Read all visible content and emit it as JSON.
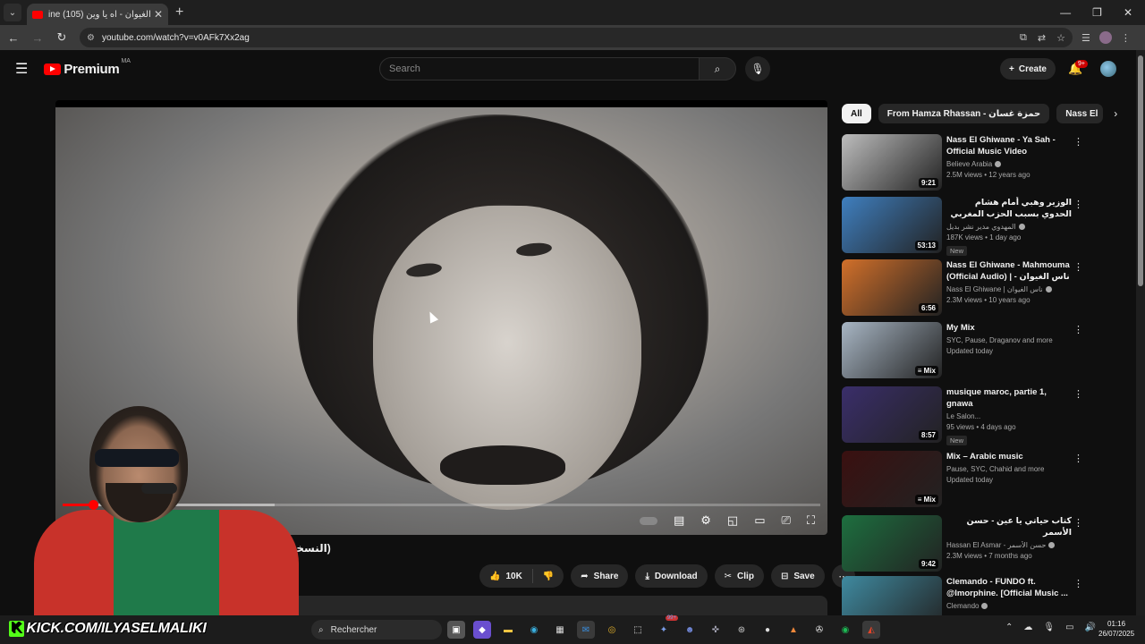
{
  "browser": {
    "tab_title": "ine ناس الغيوان - اه يا وين (105)",
    "tab_close": "✕",
    "new_tab": "+",
    "url": "youtube.com/watch?v=v0AFk7Xx2ag",
    "window": {
      "minimize": "—",
      "restore": "❐",
      "close": "✕"
    }
  },
  "youtube": {
    "logo_text": "Premium",
    "country_code": "MA",
    "search_placeholder": "Search",
    "create_label": "Create",
    "notif_count": "9+"
  },
  "video": {
    "title_visible": "(النسخة الاصـ",
    "progress_played": 0.04,
    "progress_loaded": 0.28
  },
  "actions": {
    "like_count": "10K",
    "share": "Share",
    "download": "Download",
    "clip": "Clip",
    "save": "Save"
  },
  "chips": [
    "All",
    "From Hamza Rhassan - حمزة غسان",
    "Nass El"
  ],
  "recommendations": [
    {
      "title": "Nass El Ghiwane - Ya Sah - Official Music Video",
      "channel": "Believe Arabia",
      "verified": true,
      "meta": "2.5M views • 12 years ago",
      "duration": "9:21",
      "new": false,
      "rtl": false,
      "thumb_color": "#bdbdbd"
    },
    {
      "title": "الوزير وهبي أمام هشام الحدوي بسبب الحزب المغربي الحر",
      "channel": "المهدوي مدير نشر بديل",
      "verified": true,
      "meta": "187K views • 1 day ago",
      "duration": "53:13",
      "new": true,
      "new_label": "New",
      "rtl": true,
      "thumb_color": "#3f7fbf"
    },
    {
      "title": "Nass El Ghiwane - Mahmouma (Official Audio) | ناس الغيوان - مهمومة",
      "channel": "Nass El Ghiwane | ناس الغيوان",
      "verified": true,
      "meta": "2.3M views • 10 years ago",
      "duration": "6:56",
      "new": false,
      "rtl": false,
      "thumb_color": "#d2702a"
    },
    {
      "title": "My Mix",
      "channel": "SYC, Pause, Draganov and more",
      "verified": false,
      "meta": "Updated today",
      "duration": "Mix",
      "mix": true,
      "new": false,
      "rtl": false,
      "thumb_color": "#a8b6c4"
    },
    {
      "title": "musique maroc, partie 1, gnawa",
      "channel": "Le Salon...",
      "verified": false,
      "meta": "95 views • 4 days ago",
      "duration": "8:57",
      "new": true,
      "new_label": "New",
      "rtl": false,
      "thumb_color": "#3a2e6a"
    },
    {
      "title": "Mix – Arabic music",
      "channel": "Pause, SYC, Chahid and more",
      "verified": false,
      "meta": "Updated today",
      "duration": "Mix",
      "mix": true,
      "new": false,
      "rtl": false,
      "thumb_color": "#3a1010"
    },
    {
      "title": "كتاب حياتي يا عين - حسن الأسمر",
      "channel": "Hassan El Asmar - حسن الأسمر",
      "verified": true,
      "meta": "2.3M views • 7 months ago",
      "duration": "9:42",
      "new": false,
      "rtl": true,
      "thumb_color": "#1d6f3f"
    },
    {
      "title": "Clemando - FUNDO ft. @lmorphine. [Official Music ...",
      "channel": "Clemando",
      "verified": true,
      "meta": "",
      "duration": "",
      "new": false,
      "rtl": false,
      "thumb_color": "#3f8aa0"
    }
  ],
  "taskbar": {
    "kick_text": "KICK.COM/ILYASELMALIKI",
    "kick_k": "K",
    "search_placeholder": "Rechercher",
    "notif_badge": "99+",
    "time": "01:16",
    "date": "26/07/2025"
  },
  "icons": {
    "tab_menu": "chevron-down-icon",
    "back": "arrow-left-icon",
    "forward": "arrow-right-icon",
    "reload": "reload-icon",
    "menu": "hamburger-icon",
    "search": "search-icon",
    "mic": "mic-icon",
    "bell": "bell-icon"
  }
}
